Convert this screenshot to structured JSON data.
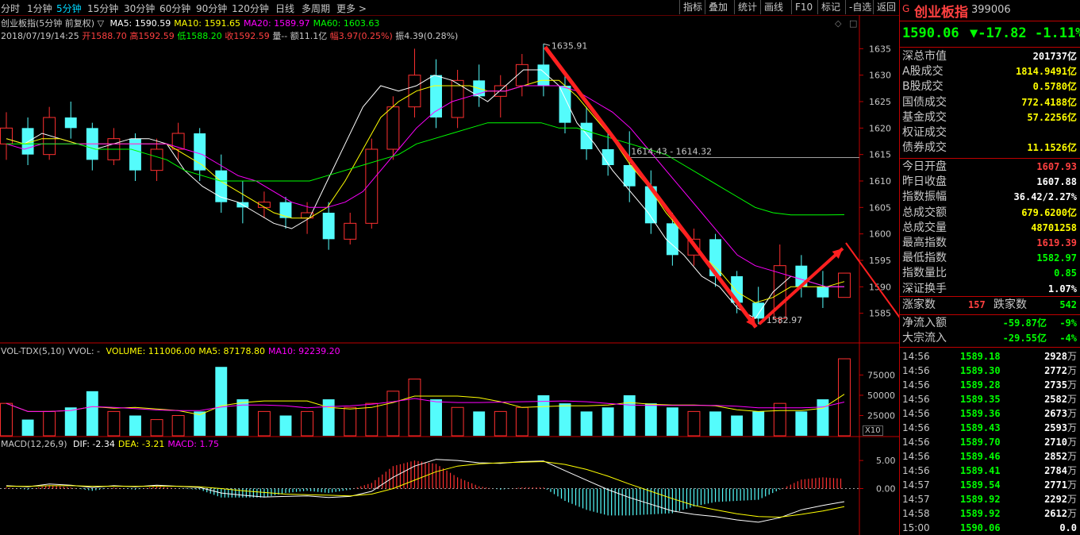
{
  "toolbar": {
    "periods": [
      "分时",
      "1分钟",
      "5分钟",
      "15分钟",
      "30分钟",
      "60分钟",
      "90分钟",
      "120分钟",
      "日线",
      "多周期",
      "更多 >"
    ],
    "active_period": "5分钟",
    "buttons": [
      "指标",
      "叠加",
      "统计",
      "画线",
      "F10",
      "标记",
      "-自选",
      "返回"
    ]
  },
  "main_chart": {
    "title": "创业板指(5分钟 前复权)",
    "ma_legend": [
      {
        "label": "MA5: 1590.59",
        "color": "#ffffff"
      },
      {
        "label": "MA10: 1591.65",
        "color": "#ffff00"
      },
      {
        "label": "MA20: 1589.97",
        "color": "#ff00ff"
      },
      {
        "label": "MA60: 1603.63",
        "color": "#00ff00"
      }
    ],
    "bar_info": {
      "datetime": "2018/07/19/14:25",
      "open_label": "开",
      "open": "1588.70",
      "high_label": "高",
      "high": "1592.59",
      "low_label": "低",
      "low": "1588.20",
      "close_label": "收",
      "close": "1592.59",
      "vol_label": "量--",
      "amount_label": "额",
      "amount": "11.1亿",
      "change_label": "幅",
      "change": "3.97(0.25%)",
      "amp_label": "振",
      "amp": "4.39(0.28%)"
    },
    "annotations": {
      "high": "1635.91",
      "low": "1582.97",
      "crosshair": "1614.43 - 1614.32"
    },
    "y_ticks": [
      "1635",
      "1630",
      "1625",
      "1620",
      "1615",
      "1610",
      "1605",
      "1600",
      "1595",
      "1590",
      "1585"
    ]
  },
  "volume_panel": {
    "title": "VOL-TDX(5,10)",
    "vvol": "VVOL: -",
    "legend": [
      {
        "label": "VOLUME: 111006.00",
        "color": "#ffff00"
      },
      {
        "label": "MA5: 87178.80",
        "color": "#ffff00"
      },
      {
        "label": "MA10: 92239.20",
        "color": "#ff00ff"
      }
    ],
    "y_ticks": [
      "75000",
      "50000",
      "25000"
    ],
    "unit": "X10"
  },
  "macd_panel": {
    "title": "MACD(12,26,9)",
    "legend": [
      {
        "label": "DIF: -2.34",
        "color": "#ffffff"
      },
      {
        "label": "DEA: -3.21",
        "color": "#ffff00"
      },
      {
        "label": "MACD: 1.75",
        "color": "#ff00ff"
      }
    ],
    "y_ticks": [
      "5.00",
      "0.00"
    ]
  },
  "chart_data": {
    "type": "candlestick",
    "title": "创业板指(5分钟 前复权)",
    "series": [
      {
        "name": "MA5",
        "values": [
          1618,
          1617,
          1619,
          1618,
          1617,
          1616,
          1617,
          1618,
          1618,
          1617,
          1612,
          1609,
          1607,
          1606,
          1604,
          1602,
          1601,
          1603,
          1610,
          1617,
          1624,
          1628,
          1627,
          1628,
          1630,
          1629,
          1627,
          1625,
          1628,
          1631,
          1631,
          1628,
          1621,
          1617,
          1612,
          1608,
          1604,
          1599,
          1596,
          1592,
          1590,
          1586,
          1584,
          1589,
          1592,
          1591,
          1590,
          1590
        ]
      },
      {
        "name": "MA10",
        "values": [
          1618,
          1617,
          1618,
          1618,
          1617,
          1617,
          1617,
          1617,
          1617,
          1617,
          1615,
          1613,
          1610,
          1608,
          1606,
          1604,
          1603,
          1603,
          1605,
          1610,
          1616,
          1622,
          1625,
          1627,
          1628,
          1628,
          1628,
          1627,
          1627,
          1628,
          1629,
          1629,
          1626,
          1622,
          1618,
          1613,
          1609,
          1604,
          1600,
          1596,
          1593,
          1589,
          1587,
          1588,
          1590,
          1590,
          1590,
          1591
        ]
      },
      {
        "name": "MA20",
        "values": [
          1617,
          1616,
          1617,
          1617,
          1617,
          1617,
          1617,
          1617,
          1617,
          1617,
          1616,
          1615,
          1613,
          1611,
          1610,
          1608,
          1606,
          1605,
          1605,
          1606,
          1608,
          1612,
          1616,
          1620,
          1623,
          1625,
          1626,
          1627,
          1627,
          1628,
          1628,
          1628,
          1627,
          1625,
          1623,
          1620,
          1616,
          1612,
          1608,
          1604,
          1600,
          1596,
          1594,
          1593,
          1592,
          1591,
          1590,
          1590
        ]
      },
      {
        "name": "MA60",
        "values": [
          1617,
          1617,
          1617,
          1617,
          1617,
          1616,
          1616,
          1616,
          1615,
          1614,
          1612,
          1611,
          1610,
          1610,
          1610,
          1610,
          1610,
          1610,
          1611,
          1612,
          1613,
          1614,
          1615,
          1617,
          1618,
          1619,
          1620,
          1621,
          1621,
          1621,
          1621,
          1620,
          1620,
          1619,
          1618,
          1617,
          1616,
          1615,
          1613,
          1611,
          1609,
          1607,
          1605,
          1604,
          1603.6,
          1603.6,
          1603.6,
          1603.63
        ]
      }
    ],
    "candles": [
      [
        1617,
        1623,
        1614,
        1620
      ],
      [
        1620,
        1622,
        1613,
        1615
      ],
      [
        1615,
        1624,
        1614,
        1622
      ],
      [
        1622,
        1625,
        1618,
        1620
      ],
      [
        1620,
        1621,
        1612,
        1614
      ],
      [
        1614,
        1620,
        1613,
        1618
      ],
      [
        1618,
        1619,
        1610,
        1612
      ],
      [
        1612,
        1618,
        1610,
        1616
      ],
      [
        1616,
        1621,
        1614,
        1619
      ],
      [
        1619,
        1620,
        1610,
        1612
      ],
      [
        1612,
        1615,
        1604,
        1606
      ],
      [
        1606,
        1610,
        1602,
        1605
      ],
      [
        1605,
        1608,
        1603,
        1606
      ],
      [
        1606,
        1607,
        1601,
        1603
      ],
      [
        1603,
        1606,
        1600,
        1604
      ],
      [
        1604,
        1606,
        1597,
        1599
      ],
      [
        1599,
        1604,
        1598,
        1602
      ],
      [
        1602,
        1618,
        1601,
        1616
      ],
      [
        1616,
        1626,
        1614,
        1624
      ],
      [
        1624,
        1635,
        1622,
        1630
      ],
      [
        1630,
        1633,
        1620,
        1622
      ],
      [
        1622,
        1631,
        1620,
        1629
      ],
      [
        1629,
        1632,
        1624,
        1626
      ],
      [
        1626,
        1630,
        1622,
        1628
      ],
      [
        1628,
        1634,
        1626,
        1632
      ],
      [
        1632,
        1635.91,
        1626,
        1628
      ],
      [
        1628,
        1630,
        1619,
        1621
      ],
      [
        1621,
        1624,
        1614,
        1616
      ],
      [
        1616,
        1620,
        1611,
        1613
      ],
      [
        1613,
        1619.39,
        1606,
        1609
      ],
      [
        1609,
        1612,
        1600,
        1602
      ],
      [
        1602,
        1604,
        1594,
        1596
      ],
      [
        1596,
        1601,
        1594,
        1599
      ],
      [
        1599,
        1600,
        1590,
        1592
      ],
      [
        1592,
        1593,
        1585,
        1587
      ],
      [
        1587,
        1590,
        1582.97,
        1584
      ],
      [
        1584,
        1598,
        1583,
        1594
      ],
      [
        1594,
        1596,
        1588,
        1590
      ],
      [
        1590,
        1593,
        1586,
        1588
      ],
      [
        1588,
        1592.59,
        1588.2,
        1592.59
      ]
    ],
    "volume": [
      40,
      20,
      30,
      35,
      55,
      30,
      25,
      20,
      25,
      30,
      85,
      45,
      30,
      25,
      30,
      45,
      35,
      40,
      55,
      70,
      45,
      35,
      30,
      30,
      35,
      50,
      40,
      30,
      35,
      50,
      40,
      35,
      30,
      30,
      25,
      30,
      40,
      30,
      45,
      111
    ],
    "macd_dif": [
      0.5,
      0.3,
      0.8,
      0.6,
      0.2,
      0.5,
      0.3,
      0.6,
      0.4,
      0.2,
      -0.8,
      -1.2,
      -1.5,
      -1.4,
      -1.3,
      -1.6,
      -1.4,
      -0.5,
      2.0,
      4.0,
      5.2,
      5.0,
      4.6,
      4.5,
      4.8,
      4.9,
      3.2,
      1.5,
      -0.2,
      -1.6,
      -2.8,
      -4.0,
      -4.6,
      -5.0,
      -5.6,
      -6.0,
      -5.2,
      -3.8,
      -3.0,
      -2.34
    ],
    "macd_dea": [
      0.4,
      0.4,
      0.5,
      0.5,
      0.4,
      0.4,
      0.4,
      0.4,
      0.4,
      0.3,
      0.0,
      -0.4,
      -0.7,
      -1.0,
      -1.1,
      -1.2,
      -1.3,
      -1.0,
      0.0,
      1.5,
      3.0,
      4.0,
      4.4,
      4.6,
      4.7,
      4.8,
      4.3,
      3.4,
      2.2,
      0.8,
      -0.5,
      -1.8,
      -3.0,
      -3.8,
      -4.5,
      -5.0,
      -5.1,
      -4.6,
      -4.0,
      -3.21
    ],
    "ylim": [
      1580,
      1637
    ],
    "ylabel": "",
    "xlabel": ""
  },
  "right_panel": {
    "header": {
      "marker": "G",
      "name": "创业板指",
      "code": "399006"
    },
    "price": {
      "last": "1590.06",
      "change": "▼-17.82",
      "pct": "-1.11%"
    },
    "rows1": [
      {
        "label": "深总市值",
        "value": "201737亿",
        "color": "#ffffff"
      },
      {
        "label": "A股成交",
        "value": "1814.9491亿",
        "color": "#ffff00"
      },
      {
        "label": "B股成交",
        "value": "0.5780亿",
        "color": "#ffff00"
      },
      {
        "label": "国债成交",
        "value": "772.4188亿",
        "color": "#ffff00"
      },
      {
        "label": "基金成交",
        "value": "57.2256亿",
        "color": "#ffff00"
      },
      {
        "label": "权证成交",
        "value": "",
        "color": "#ffff00"
      },
      {
        "label": "债券成交",
        "value": "11.1526亿",
        "color": "#ffff00"
      }
    ],
    "rows2": [
      {
        "label": "今日开盘",
        "value": "1607.93",
        "color": "#ff4040"
      },
      {
        "label": "昨日收盘",
        "value": "1607.88",
        "color": "#ffffff"
      },
      {
        "label": "指数振幅",
        "value": "36.42/2.27%",
        "color": "#ffffff"
      },
      {
        "label": "总成交额",
        "value": "679.6200亿",
        "color": "#ffff00"
      },
      {
        "label": "总成交量",
        "value": "48701258",
        "color": "#ffff00"
      },
      {
        "label": "最高指数",
        "value": "1619.39",
        "color": "#ff4040"
      },
      {
        "label": "最低指数",
        "value": "1582.97",
        "color": "#00ff00"
      },
      {
        "label": "指数量比",
        "value": "0.85",
        "color": "#00ff00"
      },
      {
        "label": "深证换手",
        "value": "1.07%",
        "color": "#ffffff"
      }
    ],
    "updown": {
      "up_label": "涨家数",
      "up": "157",
      "down_label": "跌家数",
      "down": "542"
    },
    "flows": [
      {
        "label": "净流入额",
        "value": "-59.87亿",
        "pct": "-9%"
      },
      {
        "label": "大宗流入",
        "value": "-29.55亿",
        "pct": "-4%"
      }
    ],
    "ticks": [
      {
        "time": "14:56",
        "price": "1589.18",
        "vol": "2928",
        "unit": "万"
      },
      {
        "time": "14:56",
        "price": "1589.30",
        "vol": "2772",
        "unit": "万"
      },
      {
        "time": "14:56",
        "price": "1589.28",
        "vol": "2735",
        "unit": "万"
      },
      {
        "time": "14:56",
        "price": "1589.35",
        "vol": "2582",
        "unit": "万"
      },
      {
        "time": "14:56",
        "price": "1589.36",
        "vol": "2673",
        "unit": "万"
      },
      {
        "time": "14:56",
        "price": "1589.43",
        "vol": "2593",
        "unit": "万"
      },
      {
        "time": "14:56",
        "price": "1589.70",
        "vol": "2710",
        "unit": "万"
      },
      {
        "time": "14:56",
        "price": "1589.46",
        "vol": "2852",
        "unit": "万"
      },
      {
        "time": "14:56",
        "price": "1589.41",
        "vol": "2784",
        "unit": "万"
      },
      {
        "time": "14:57",
        "price": "1589.54",
        "vol": "2771",
        "unit": "万"
      },
      {
        "time": "14:57",
        "price": "1589.92",
        "vol": "2292",
        "unit": "万"
      },
      {
        "time": "14:58",
        "price": "1589.92",
        "vol": "2612",
        "unit": "万"
      },
      {
        "time": "15:00",
        "price": "1590.06",
        "vol": "0.0",
        "unit": ""
      }
    ]
  }
}
